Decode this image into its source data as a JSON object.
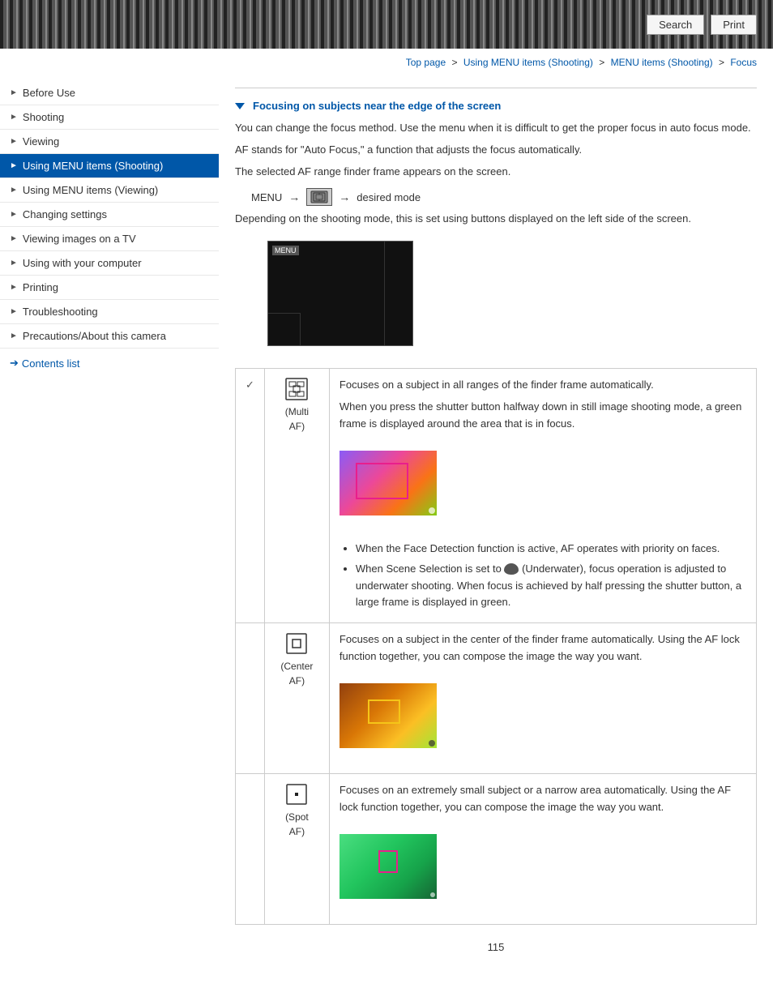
{
  "topbar": {
    "search_label": "Search",
    "print_label": "Print"
  },
  "breadcrumb": {
    "top_page": "Top page",
    "using_menu_items_shooting": "Using MENU items (Shooting)",
    "menu_items_shooting": "MENU items (Shooting)",
    "focus": "Focus"
  },
  "sidebar": {
    "items": [
      {
        "label": "Before Use",
        "active": false
      },
      {
        "label": "Shooting",
        "active": false
      },
      {
        "label": "Viewing",
        "active": false
      },
      {
        "label": "Using MENU items (Shooting)",
        "active": true
      },
      {
        "label": "Using MENU items (Viewing)",
        "active": false
      },
      {
        "label": "Changing settings",
        "active": false
      },
      {
        "label": "Viewing images on a TV",
        "active": false
      },
      {
        "label": "Using with your computer",
        "active": false
      },
      {
        "label": "Printing",
        "active": false
      },
      {
        "label": "Troubleshooting",
        "active": false
      },
      {
        "label": "Precautions/About this camera",
        "active": false
      }
    ],
    "contents_link": "Contents list"
  },
  "content": {
    "section_title": "Focusing on subjects near the edge of the screen",
    "para1": "You can change the focus method. Use the menu when it is difficult to get the proper focus in auto focus mode.",
    "para2": "AF stands for \"Auto Focus,\" a function that adjusts the focus automatically.",
    "para3": "The selected AF range finder frame appears on the screen.",
    "menu_line": "MENU →  (Focus) → desired mode",
    "menu_icon_text": "Focus",
    "para4": "Depending on the shooting mode, this is set using buttons displayed on the left side of the screen.",
    "af_rows": [
      {
        "icon_label": "(Multi\nAF)",
        "has_check": true,
        "text1": "Focuses on a subject in all ranges of the finder frame automatically.",
        "text2": "When you press the shutter button halfway down in still image shooting mode, a green frame is displayed around the area that is in focus.",
        "bullets": [
          "When the Face Detection function is active, AF operates with priority on faces.",
          "When Scene Selection is set to  (Underwater), focus operation is adjusted to underwater shooting. When focus is achieved by half pressing the shutter button, a large frame is displayed in green."
        ]
      },
      {
        "icon_label": "(Center\nAF)",
        "has_check": false,
        "text1": "Focuses on a subject in the center of the finder frame automatically. Using the AF lock function together, you can compose the image the way you want.",
        "bullets": []
      },
      {
        "icon_label": "(Spot\nAF)",
        "has_check": false,
        "text1": "Focuses on an extremely small subject or a narrow area automatically. Using the AF lock function together, you can compose the image the way you want.",
        "bullets": []
      }
    ],
    "page_number": "115"
  }
}
